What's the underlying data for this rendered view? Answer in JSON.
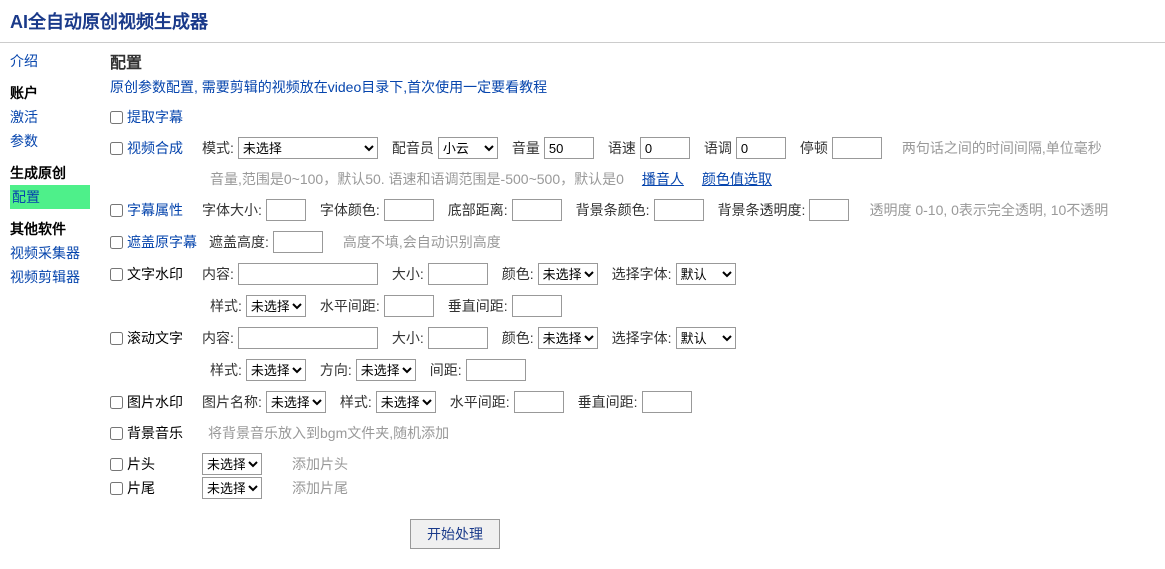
{
  "header": {
    "title": "AI全自动原创视频生成器"
  },
  "sidebar": {
    "intro": "介绍",
    "section_account": "账户",
    "activate": "激活",
    "params": "参数",
    "section_generate": "生成原创",
    "config": "配置",
    "section_other": "其他软件",
    "collector": "视频采集器",
    "editor": "视频剪辑器"
  },
  "main": {
    "title": "配置",
    "subtitle": "原创参数配置, 需要剪辑的视频放在video目录下,首次使用一定要看教程",
    "extract_subtitle": "提取字幕",
    "video_synth": {
      "label": "视频合成",
      "mode_label": "模式:",
      "mode_value": "未选择",
      "voicer_label": "配音员",
      "voicer_value": "小云",
      "volume_label": "音量",
      "volume_value": "50",
      "speed_label": "语速",
      "speed_value": "0",
      "pitch_label": "语调",
      "pitch_value": "0",
      "pause_label": "停顿",
      "pause_value": "",
      "pause_hint": "两句话之间的时间间隔,单位毫秒",
      "range_hint": "音量,范围是0~100，默认50. 语速和语调范围是-500~500，默认是0",
      "link_voicer": "播音人",
      "link_color": "颜色值选取"
    },
    "font_attr": {
      "label": "字幕属性",
      "size_label": "字体大小:",
      "color_label": "字体颜色:",
      "bottom_label": "底部距离:",
      "bgcolor_label": "背景条颜色:",
      "bgalpha_label": "背景条透明度:",
      "alpha_hint": "透明度 0-10, 0表示完全透明, 10不透明"
    },
    "mask_sub": {
      "label": "遮盖原字幕",
      "height_label": "遮盖高度:",
      "height_hint": "高度不填,会自动识别高度"
    },
    "text_wm": {
      "label": "文字水印",
      "content_label": "内容:",
      "size_label": "大小:",
      "color_label": "颜色:",
      "color_value": "未选择",
      "font_label": "选择字体:",
      "font_value": "默认",
      "style_label": "样式:",
      "style_value": "未选择",
      "hspace_label": "水平间距:",
      "vspace_label": "垂直间距:"
    },
    "scroll_text": {
      "label": "滚动文字",
      "content_label": "内容:",
      "size_label": "大小:",
      "color_label": "颜色:",
      "color_value": "未选择",
      "font_label": "选择字体:",
      "font_value": "默认",
      "style_label": "样式:",
      "style_value": "未选择",
      "direction_label": "方向:",
      "direction_value": "未选择",
      "gap_label": "间距:"
    },
    "image_wm": {
      "label": "图片水印",
      "name_label": "图片名称:",
      "name_value": "未选择",
      "style_label": "样式:",
      "style_value": "未选择",
      "hspace_label": "水平间距:",
      "vspace_label": "垂直间距:"
    },
    "bgm": {
      "label": "背景音乐",
      "hint": "将背景音乐放入到bgm文件夹,随机添加"
    },
    "head": {
      "label": "片头",
      "value": "未选择",
      "hint": "添加片头"
    },
    "tail": {
      "label": "片尾",
      "value": "未选择",
      "hint": "添加片尾"
    },
    "submit": "开始处理"
  }
}
